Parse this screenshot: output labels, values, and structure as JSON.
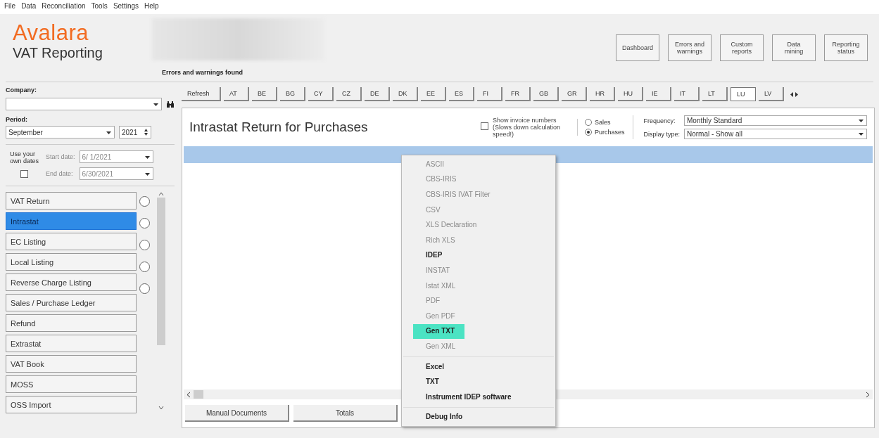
{
  "menu_bar": [
    "File",
    "Data",
    "Reconciliation",
    "Tools",
    "Settings",
    "Help"
  ],
  "header": {
    "logo": "Avalara",
    "product": "VAT Reporting",
    "notice": "Errors and warnings found",
    "buttons": [
      [
        "Dashboard"
      ],
      [
        "Errors and",
        "warnings"
      ],
      [
        "Custom",
        "reports"
      ],
      [
        "Data",
        "mining"
      ],
      [
        "Reporting",
        "status"
      ]
    ]
  },
  "sidebar": {
    "company_label": "Company:",
    "period_label": "Period:",
    "month": "September",
    "year": "2021",
    "own_dates": {
      "label": [
        "Use your",
        "own dates"
      ],
      "checked": false,
      "start_label": "Start date:",
      "start": "6/ 1/2021",
      "end_label": "End date:",
      "end": "6/30/2021",
      "disabled": true
    },
    "items": [
      {
        "label": "VAT Return",
        "selected": false,
        "kind": "indicator"
      },
      {
        "label": "Intrastat",
        "selected": true,
        "kind": "indicator"
      },
      {
        "label": "EC Listing",
        "selected": false,
        "kind": "indicator"
      },
      {
        "label": "Local Listing",
        "selected": false,
        "kind": "indicator"
      },
      {
        "label": "Reverse Charge Listing",
        "selected": false,
        "kind": "indicator"
      },
      {
        "label": "Sales / Purchase Ledger",
        "selected": false,
        "kind": "plain"
      },
      {
        "label": "Refund",
        "selected": false,
        "kind": "plain"
      },
      {
        "label": "Extrastat",
        "selected": false,
        "kind": "plain"
      },
      {
        "label": "VAT Book",
        "selected": false,
        "kind": "plain"
      },
      {
        "label": "MOSS",
        "selected": false,
        "kind": "plain"
      },
      {
        "label": "OSS Import",
        "selected": false,
        "kind": "plain"
      }
    ]
  },
  "toolbar": {
    "refresh": "Refresh",
    "countries": [
      {
        "label": "AT",
        "selected": false
      },
      {
        "label": "BE",
        "selected": false
      },
      {
        "label": "BG",
        "selected": false
      },
      {
        "label": "CY",
        "selected": false
      },
      {
        "label": "CZ",
        "selected": false
      },
      {
        "label": "DE",
        "selected": false
      },
      {
        "label": "DK",
        "selected": false
      },
      {
        "label": "EE",
        "selected": false
      },
      {
        "label": "ES",
        "selected": false
      },
      {
        "label": "FI",
        "selected": false
      },
      {
        "label": "FR",
        "selected": false
      },
      {
        "label": "GB",
        "selected": false
      },
      {
        "label": "GR",
        "selected": false
      },
      {
        "label": "HR",
        "selected": false
      },
      {
        "label": "HU",
        "selected": false
      },
      {
        "label": "IE",
        "selected": false
      },
      {
        "label": "IT",
        "selected": false
      },
      {
        "label": "LT",
        "selected": false
      },
      {
        "label": "LU",
        "selected": true
      },
      {
        "label": "LV",
        "selected": false
      }
    ]
  },
  "panel": {
    "title": "Intrastat Return for Purchases",
    "show_invoices": {
      "label": "Show invoice numbers (Slows down calculation speed!)",
      "checked": false
    },
    "flow": [
      {
        "label": "Sales",
        "selected": false
      },
      {
        "label": "Purchases",
        "selected": true
      }
    ],
    "frequency_label": "Frequency:",
    "frequency": "Monthly Standard",
    "display_label": "Display type:",
    "display": "Normal - Show all",
    "bottom_buttons": [
      "Manual Documents",
      "Totals"
    ]
  },
  "context_menu": [
    [
      {
        "label": "ASCII",
        "disabled": true,
        "selected": false
      },
      {
        "label": "CBS-IRIS",
        "disabled": true,
        "selected": false
      },
      {
        "label": "CBS-IRIS IVAT Filter",
        "disabled": true,
        "selected": false
      },
      {
        "label": "CSV",
        "disabled": true,
        "selected": false
      },
      {
        "label": "XLS Declaration",
        "disabled": true,
        "selected": false
      },
      {
        "label": "Rich XLS",
        "disabled": true,
        "selected": false
      },
      {
        "label": "IDEP",
        "disabled": false,
        "selected": false
      },
      {
        "label": "INSTAT",
        "disabled": true,
        "selected": false
      },
      {
        "label": "Istat XML",
        "disabled": true,
        "selected": false
      },
      {
        "label": "PDF",
        "disabled": true,
        "selected": false
      },
      {
        "label": "Gen PDF",
        "disabled": true,
        "selected": false
      },
      {
        "label": "Gen TXT",
        "disabled": false,
        "selected": true
      },
      {
        "label": "Gen XML",
        "disabled": true,
        "selected": false
      }
    ],
    [
      {
        "label": "Excel",
        "disabled": false,
        "selected": false
      },
      {
        "label": "TXT",
        "disabled": false,
        "selected": false
      },
      {
        "label": "Instrument IDEP software",
        "disabled": false,
        "selected": false
      }
    ],
    [
      {
        "label": "Debug Info",
        "disabled": false,
        "selected": false
      }
    ]
  ]
}
